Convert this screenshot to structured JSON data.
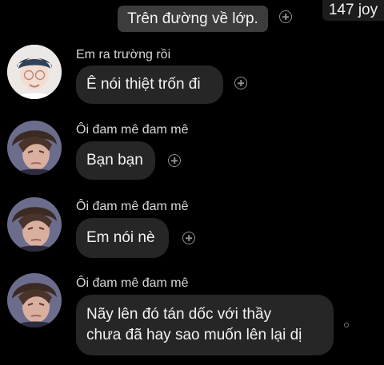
{
  "counter": "147 joy",
  "top_message": "Trên đường về lớp.",
  "messages": [
    {
      "sender": "Em ra trường rồi",
      "text": "Ê nói thiệt trốn đi"
    },
    {
      "sender": "Ôi đam mê đam mê",
      "text": "Bạn bạn"
    },
    {
      "sender": "Ôi đam mê đam mê",
      "text": "Em nói nè"
    },
    {
      "sender": "Ôi đam mê đam mê",
      "lines": [
        "Nãy lên đó tán dốc với thầy",
        "chưa đã hay sao muốn lên lại dị"
      ]
    }
  ],
  "colors": {
    "background": "#000000",
    "bubble": "#262626",
    "sent_bubble": "#3c3c3c"
  }
}
